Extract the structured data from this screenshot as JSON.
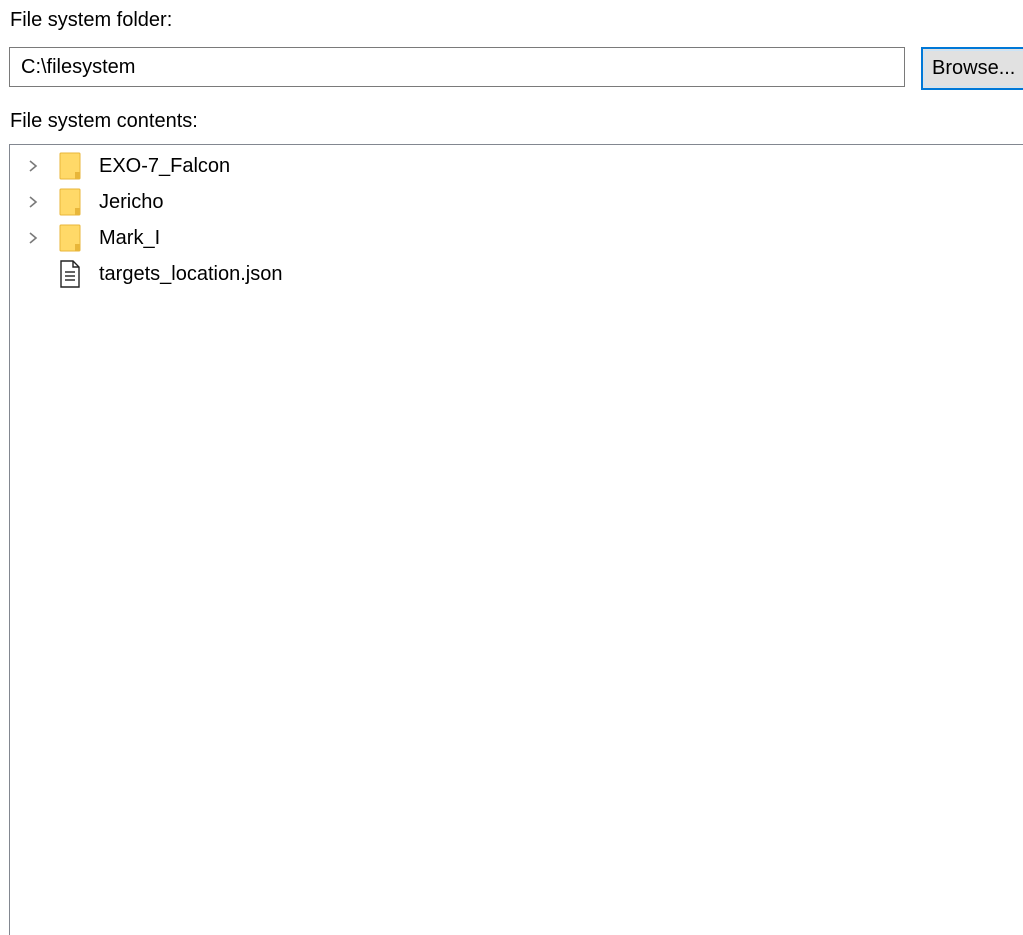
{
  "folder_section": {
    "label": "File system folder:",
    "path_value": "C:\\filesystem",
    "browse_label": "Browse..."
  },
  "contents_section": {
    "label": "File system contents:",
    "items": [
      {
        "name": "EXO-7_Falcon",
        "type": "folder",
        "icon": "folder-icon",
        "expandable": true
      },
      {
        "name": "Jericho",
        "type": "folder",
        "icon": "folder-icon",
        "expandable": true
      },
      {
        "name": "Mark_I",
        "type": "folder",
        "icon": "folder-icon",
        "expandable": true
      },
      {
        "name": "targets_location.json",
        "type": "file",
        "icon": "document-icon",
        "expandable": false
      }
    ]
  },
  "colors": {
    "accent": "#0078d7",
    "folder_fill": "#ffd968",
    "folder_edge": "#e8b63a",
    "border": "#7a7a7a",
    "button_bg": "#e1e1e1"
  }
}
